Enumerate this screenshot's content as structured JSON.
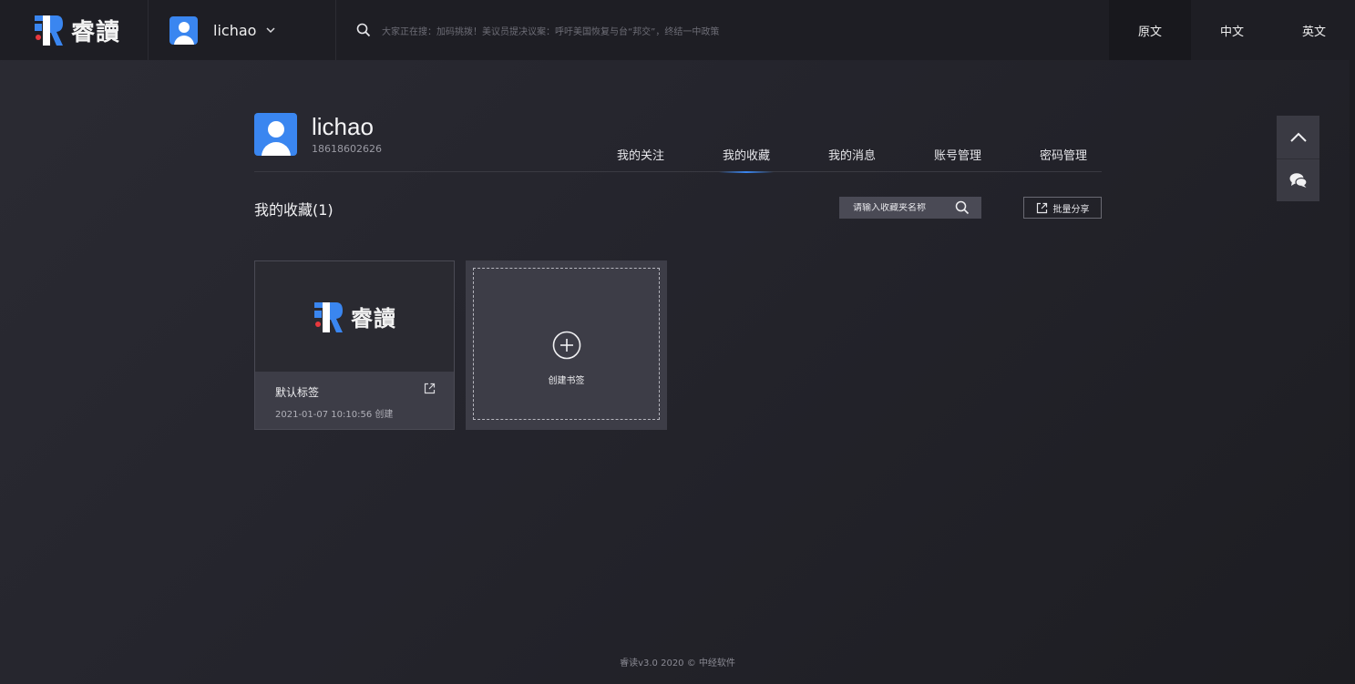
{
  "header": {
    "logo_text": "睿讀",
    "user_name": "lichao",
    "search_hint": "大家正在搜：加码挑拨！美议员提决议案：呼吁美国恢复与台“邦交”，终结一中政策",
    "languages": [
      "原文",
      "中文",
      "英文"
    ],
    "active_language": "原文"
  },
  "profile": {
    "name": "lichao",
    "phone": "18618602626",
    "tabs": [
      "我的关注",
      "我的收藏",
      "我的消息",
      "账号管理",
      "密码管理"
    ],
    "active_tab": "我的收藏"
  },
  "favorites": {
    "title": "我的收藏(1)",
    "search_placeholder": "请输入收藏夹名称",
    "share_label": "批量分享",
    "cards": [
      {
        "cover_text": "睿讀",
        "title": "默认标签",
        "date": "2021-01-07 10:10:56 创建"
      }
    ],
    "create_label": "创建书签"
  },
  "colors": {
    "accent": "#3a86f0",
    "background": "#25252d",
    "topbar": "#1e1e24"
  },
  "footer": {
    "text": "睿读v3.0 2020 © 中经软件"
  }
}
